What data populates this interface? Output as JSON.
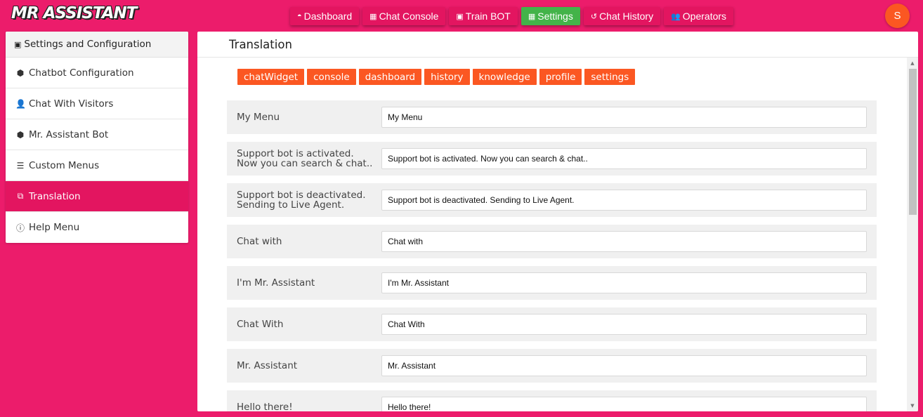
{
  "app": {
    "logo_text": "MR ASSISTANT",
    "avatar_initial": "S"
  },
  "topnav": [
    {
      "name": "dashboard",
      "icon": "gauge-icon",
      "glyph": "◓",
      "label": "Dashboard",
      "active": false
    },
    {
      "name": "chat-console",
      "icon": "grid-icon",
      "glyph": "▦",
      "label": "Chat Console",
      "active": false
    },
    {
      "name": "train-bot",
      "icon": "robot-icon",
      "glyph": "▣",
      "label": "Train BOT",
      "active": false
    },
    {
      "name": "settings",
      "icon": "settings-icon",
      "glyph": "▦",
      "label": "Settings",
      "active": true
    },
    {
      "name": "chat-history",
      "icon": "history-icon",
      "glyph": "↺",
      "label": "Chat History",
      "active": false
    },
    {
      "name": "operators",
      "icon": "users-icon",
      "glyph": "👥",
      "label": "Operators",
      "active": false
    }
  ],
  "sidebar": {
    "header": "Settings and Configuration",
    "header_glyph": "▣",
    "items": [
      {
        "name": "chatbot-configuration",
        "icon": "hexagon-icon",
        "glyph": "⬢",
        "label": "Chatbot Configuration",
        "active": false
      },
      {
        "name": "chat-with-visitors",
        "icon": "user-icon",
        "glyph": "👤",
        "label": "Chat With Visitors",
        "active": false
      },
      {
        "name": "mr-assistant-bot",
        "icon": "hexagon-icon",
        "glyph": "⬢",
        "label": "Mr. Assistant Bot",
        "active": false
      },
      {
        "name": "custom-menus",
        "icon": "list-icon",
        "glyph": "☰",
        "label": "Custom Menus",
        "active": false
      },
      {
        "name": "translation",
        "icon": "translate-icon",
        "glyph": "⧉",
        "label": "Translation",
        "active": true
      },
      {
        "name": "help-menu",
        "icon": "help-icon",
        "glyph": "ⓘ",
        "label": "Help Menu",
        "active": false
      }
    ]
  },
  "main": {
    "title": "Translation",
    "tags": [
      "chatWidget",
      "console",
      "dashboard",
      "history",
      "knowledge",
      "profile",
      "settings"
    ],
    "rows": [
      {
        "label": "My Menu",
        "value": "My Menu"
      },
      {
        "label": "Support bot is activated. Now you can search & chat..",
        "value": "Support bot is activated. Now you can search & chat.."
      },
      {
        "label": "Support bot is deactivated. Sending to Live Agent.",
        "value": "Support bot is deactivated. Sending to Live Agent."
      },
      {
        "label": "Chat with",
        "value": "Chat with"
      },
      {
        "label": "I'm Mr. Assistant",
        "value": "I'm Mr. Assistant"
      },
      {
        "label": "Chat With",
        "value": "Chat With"
      },
      {
        "label": "Mr. Assistant",
        "value": "Mr. Assistant"
      },
      {
        "label": "Hello there!",
        "value": "Hello there!"
      }
    ]
  },
  "colors": {
    "brand": "#ec1c6b",
    "nav_button": "#e31560",
    "nav_active": "#43b349",
    "tag": "#fb5722",
    "avatar": "#fb5722"
  }
}
